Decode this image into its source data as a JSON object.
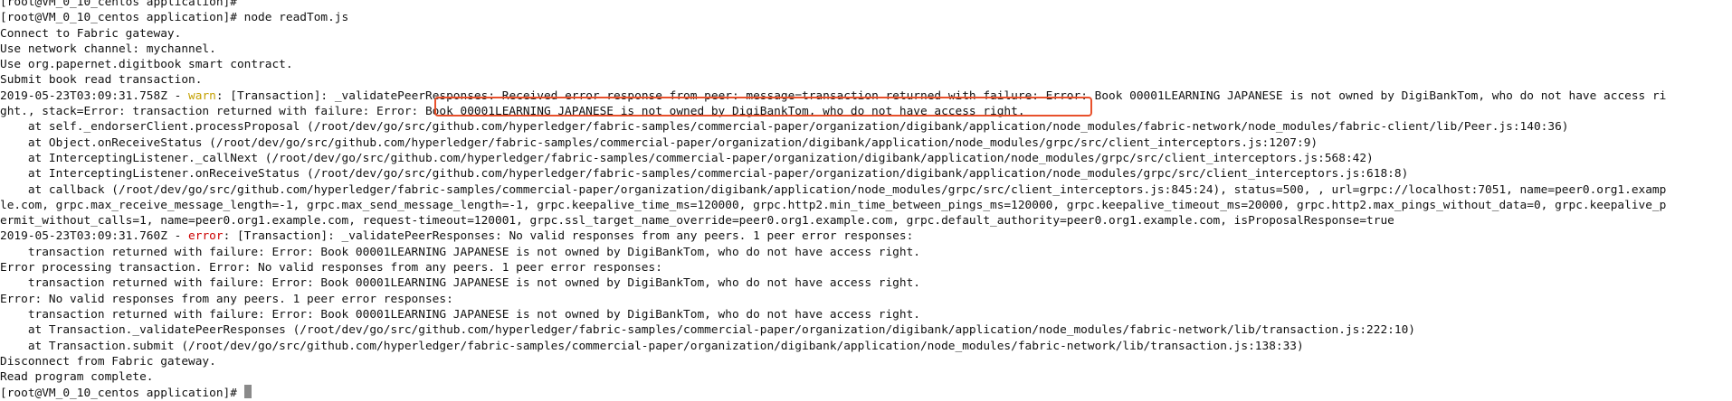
{
  "terminal": {
    "lines": [
      "[root@VM_0_10_centos application]#",
      "[root@VM_0_10_centos application]# node readTom.js",
      "Connect to Fabric gateway.",
      "Use network channel: mychannel.",
      "Use org.papernet.digitbook smart contract.",
      "Submit book read transaction.",
      {
        "prefix": "2019-05-23T03:09:31.758Z - ",
        "level": "warn",
        "rest": ": [Transaction]: _validatePeerResponses: Received error response from peer: message=transaction returned with failure: Error: Book 00001LEARNING JAPANESE is not owned by DigiBankTom, who do not have access ri"
      },
      "ght., stack=Error: transaction returned with failure: Error: Book 00001LEARNING JAPANESE is not owned by DigiBankTom, who do not have access right.",
      "    at self._endorserClient.processProposal (/root/dev/go/src/github.com/hyperledger/fabric-samples/commercial-paper/organization/digibank/application/node_modules/fabric-network/node_modules/fabric-client/lib/Peer.js:140:36)",
      "    at Object.onReceiveStatus (/root/dev/go/src/github.com/hyperledger/fabric-samples/commercial-paper/organization/digibank/application/node_modules/grpc/src/client_interceptors.js:1207:9)",
      "    at InterceptingListener._callNext (/root/dev/go/src/github.com/hyperledger/fabric-samples/commercial-paper/organization/digibank/application/node_modules/grpc/src/client_interceptors.js:568:42)",
      "    at InterceptingListener.onReceiveStatus (/root/dev/go/src/github.com/hyperledger/fabric-samples/commercial-paper/organization/digibank/application/node_modules/grpc/src/client_interceptors.js:618:8)",
      "    at callback (/root/dev/go/src/github.com/hyperledger/fabric-samples/commercial-paper/organization/digibank/application/node_modules/grpc/src/client_interceptors.js:845:24), status=500, , url=grpc://localhost:7051, name=peer0.org1.examp",
      "le.com, grpc.max_receive_message_length=-1, grpc.max_send_message_length=-1, grpc.keepalive_time_ms=120000, grpc.http2.min_time_between_pings_ms=120000, grpc.keepalive_timeout_ms=20000, grpc.http2.max_pings_without_data=0, grpc.keepalive_p",
      "ermit_without_calls=1, name=peer0.org1.example.com, request-timeout=120001, grpc.ssl_target_name_override=peer0.org1.example.com, grpc.default_authority=peer0.org1.example.com, isProposalResponse=true",
      {
        "prefix": "2019-05-23T03:09:31.760Z - ",
        "level": "error",
        "rest": ": [Transaction]: _validatePeerResponses: No valid responses from any peers. 1 peer error responses:"
      },
      "    transaction returned with failure: Error: Book 00001LEARNING JAPANESE is not owned by DigiBankTom, who do not have access right.",
      "Error processing transaction. Error: No valid responses from any peers. 1 peer error responses:",
      "    transaction returned with failure: Error: Book 00001LEARNING JAPANESE is not owned by DigiBankTom, who do not have access right.",
      "Error: No valid responses from any peers. 1 peer error responses:",
      "    transaction returned with failure: Error: Book 00001LEARNING JAPANESE is not owned by DigiBankTom, who do not have access right.",
      "    at Transaction._validatePeerResponses (/root/dev/go/src/github.com/hyperledger/fabric-samples/commercial-paper/organization/digibank/application/node_modules/fabric-network/lib/transaction.js:222:10)",
      "    at Transaction.submit (/root/dev/go/src/github.com/hyperledger/fabric-samples/commercial-paper/organization/digibank/application/node_modules/fabric-network/lib/transaction.js:138:33)",
      "Disconnect from Fabric gateway.",
      "Read program complete.",
      "[root@VM_0_10_centos application]# "
    ],
    "colors": {
      "text": "#111111",
      "warn": "#c4a000",
      "error": "#cc0000",
      "highlight_border": "#e8502b",
      "cursor": "#8a8a8a"
    }
  }
}
